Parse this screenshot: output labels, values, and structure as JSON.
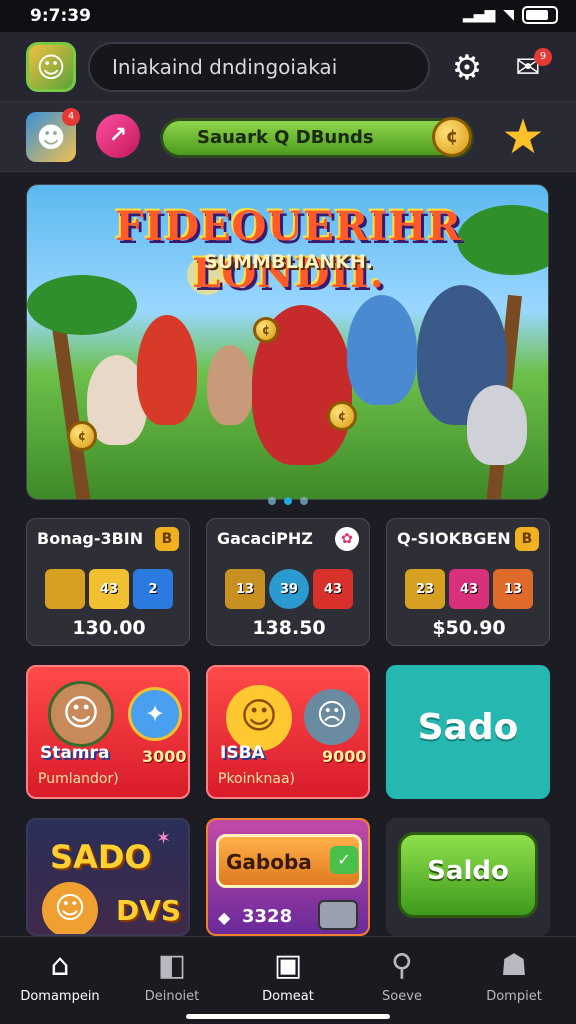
{
  "status": {
    "time": "9:7:39"
  },
  "header": {
    "search_placeholder": "Iniakaind dndingoiakai",
    "mail_badge": "9"
  },
  "subheader": {
    "bonus_label": "Sauark Q DBunds",
    "badge_count": "4"
  },
  "hero": {
    "title": "FIDEOUERIHR LONDII.",
    "subtitle": "SUMMBLIANKH.",
    "page_dots": 3,
    "active_dot": 1
  },
  "packs": [
    {
      "name": "Bonag-3BIN",
      "price": "130.00",
      "badge": "B",
      "item_labels": [
        "",
        "43",
        "2"
      ]
    },
    {
      "name": "GacaciPHZ",
      "price": "138.50",
      "badge": "✿",
      "item_labels": [
        "13",
        "39",
        "43"
      ]
    },
    {
      "name": "Q-SIOKBGEN",
      "price": "$50.90",
      "badge": "B",
      "item_labels": [
        "23",
        "43",
        "13"
      ]
    }
  ],
  "promos": {
    "card1": {
      "label": "Stamra",
      "value": "3000",
      "caption": "Pumlandor)"
    },
    "card2": {
      "label": "ISBA",
      "value": "9000",
      "caption": "Pkoinknaa)"
    },
    "card3": {
      "label": "Sado"
    },
    "card4": {
      "label": "SADO",
      "value": "DVS"
    },
    "card5": {
      "label": "Gaboba",
      "value": "3328"
    },
    "card6": {
      "label": "Saldo"
    }
  },
  "nav": {
    "items": [
      {
        "label": "Domampein",
        "icon": "home-icon"
      },
      {
        "label": "Deinoiet",
        "icon": "bag-icon"
      },
      {
        "label": "Domeat",
        "icon": "card-icon"
      },
      {
        "label": "Soeve",
        "icon": "search-icon"
      },
      {
        "label": "Dompiet",
        "icon": "profile-icon"
      }
    ],
    "active_index": 0
  },
  "colors": {
    "accent_green": "#4c9a1e",
    "teal": "#26b8b0",
    "red": "#d81c2a",
    "active_dot": "#2aa8e0"
  }
}
